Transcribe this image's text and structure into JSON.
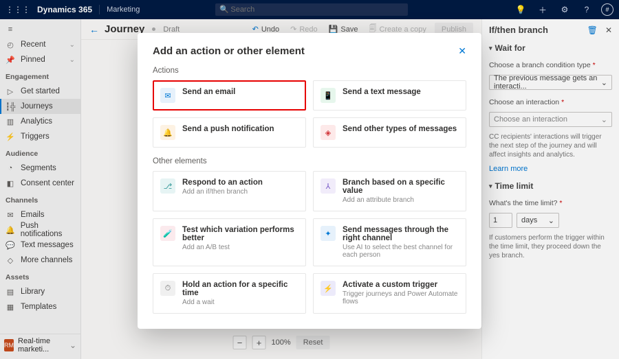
{
  "topbar": {
    "brand": "Dynamics 365",
    "module": "Marketing",
    "search_placeholder": "Search",
    "avatar_initial": "#"
  },
  "sidebar": {
    "recent": "Recent",
    "pinned": "Pinned",
    "groups": {
      "engagement": "Engagement",
      "audience": "Audience",
      "channels": "Channels",
      "assets": "Assets"
    },
    "items": {
      "get_started": "Get started",
      "journeys": "Journeys",
      "analytics": "Analytics",
      "triggers": "Triggers",
      "segments": "Segments",
      "consent_center": "Consent center",
      "emails": "Emails",
      "push_notifications": "Push notifications",
      "text_messages": "Text messages",
      "more_channels": "More channels",
      "library": "Library",
      "templates": "Templates"
    },
    "footer": {
      "badge": "RM",
      "label": "Real-time marketi..."
    }
  },
  "cmdbar": {
    "title": "Journey",
    "status": "Draft",
    "undo": "Undo",
    "redo": "Redo",
    "save": "Save",
    "copy": "Create a copy",
    "publish": "Publish"
  },
  "zoom": {
    "pct": "100%",
    "reset": "Reset"
  },
  "panel": {
    "title": "If/then branch",
    "wait_for": "Wait for",
    "branch_label": "Choose a branch condition type",
    "branch_value": "The previous message gets an interacti...",
    "interaction_label": "Choose an interaction",
    "interaction_placeholder": "Choose an interaction",
    "hint": "CC recipients' interactions will trigger the next step of the journey and will affect insights and analytics.",
    "learn_more": "Learn more",
    "time_limit": "Time limit",
    "time_q": "What's the time limit?",
    "time_value": "1",
    "time_unit": "days",
    "time_hint": "If customers perform the trigger within the time limit, they proceed down the yes branch."
  },
  "modal": {
    "title": "Add an action or other element",
    "actions_header": "Actions",
    "other_header": "Other elements",
    "actions": {
      "email": "Send an email",
      "text": "Send a text message",
      "push": "Send a push notification",
      "other_msgs": "Send other types of messages"
    },
    "other": {
      "respond_t": "Respond to an action",
      "respond_s": "Add an if/then branch",
      "branch_t": "Branch based on a specific value",
      "branch_s": "Add an attribute branch",
      "abtest_t": "Test which variation performs better",
      "abtest_s": "Add an A/B test",
      "channel_t": "Send messages through the right channel",
      "channel_s": "Use AI to select the best channel for each person",
      "hold_t": "Hold an action for a specific time",
      "hold_s": "Add a wait",
      "trigger_t": "Activate a custom trigger",
      "trigger_s": "Trigger journeys and Power Automate flows"
    }
  }
}
